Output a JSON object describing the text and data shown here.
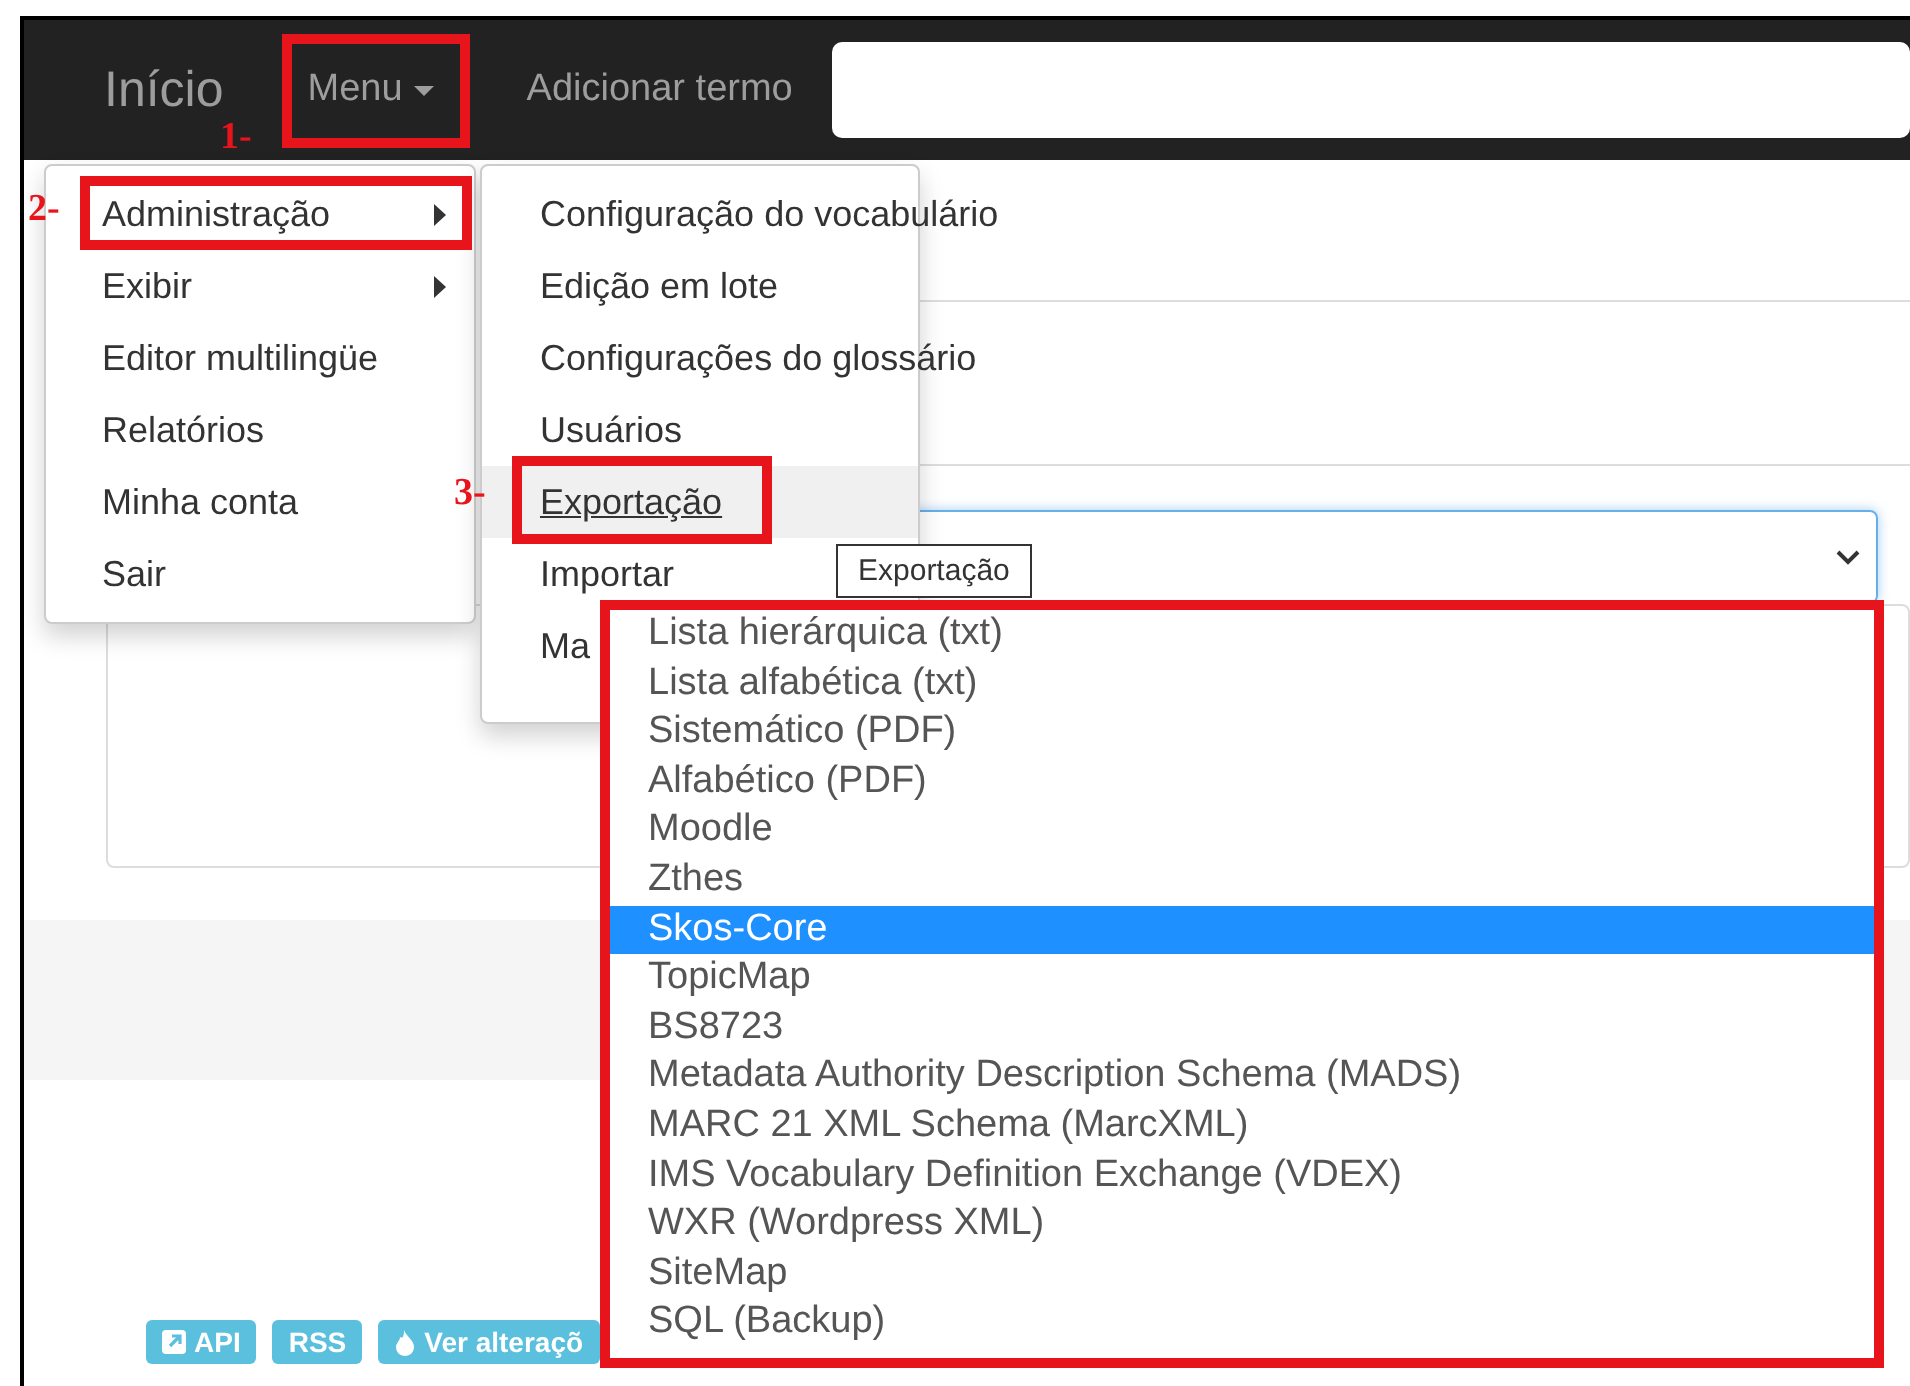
{
  "navbar": {
    "brand": "Início",
    "menu": "Menu",
    "add_term": "Adicionar termo"
  },
  "main_menu": [
    {
      "label": "Administração",
      "has_submenu": true
    },
    {
      "label": "Exibir",
      "has_submenu": true
    },
    {
      "label": "Editor multilingüe",
      "has_submenu": false
    },
    {
      "label": "Relatórios",
      "has_submenu": false
    },
    {
      "label": "Minha conta",
      "has_submenu": false
    },
    {
      "label": "Sair",
      "has_submenu": false
    }
  ],
  "submenu": [
    {
      "label": "Configuração do vocabulário",
      "selected": false
    },
    {
      "label": "Edição em lote",
      "selected": false
    },
    {
      "label": "Configurações do glossário",
      "selected": false
    },
    {
      "label": "Usuários",
      "selected": false
    },
    {
      "label": "Exportação",
      "selected": true
    },
    {
      "label": "Importar",
      "selected": false
    },
    {
      "label": "Ma",
      "selected": false
    }
  ],
  "tooltip": "Exportação",
  "format_options": [
    {
      "label": "Lista hierárquica (txt)",
      "selected": false
    },
    {
      "label": "Lista alfabética (txt)",
      "selected": false
    },
    {
      "label": "Sistemático (PDF)",
      "selected": false
    },
    {
      "label": "Alfabético (PDF)",
      "selected": false
    },
    {
      "label": "Moodle",
      "selected": false
    },
    {
      "label": "Zthes",
      "selected": false
    },
    {
      "label": "Skos-Core",
      "selected": true
    },
    {
      "label": "TopicMap",
      "selected": false
    },
    {
      "label": "BS8723",
      "selected": false
    },
    {
      "label": "Metadata Authority Description Schema (MADS)",
      "selected": false
    },
    {
      "label": "MARC 21 XML Schema (MarcXML)",
      "selected": false
    },
    {
      "label": "IMS Vocabulary Definition Exchange (VDEX)",
      "selected": false
    },
    {
      "label": "WXR (Wordpress XML)",
      "selected": false
    },
    {
      "label": "SiteMap",
      "selected": false
    },
    {
      "label": "SQL (Backup)",
      "selected": false
    }
  ],
  "footer_badges": [
    {
      "label": "API",
      "kind": "external"
    },
    {
      "label": "RSS",
      "kind": "plain"
    },
    {
      "label": "Ver alteraçõ",
      "kind": "fire"
    }
  ],
  "annotations": [
    "1-",
    "2-",
    "3-"
  ]
}
